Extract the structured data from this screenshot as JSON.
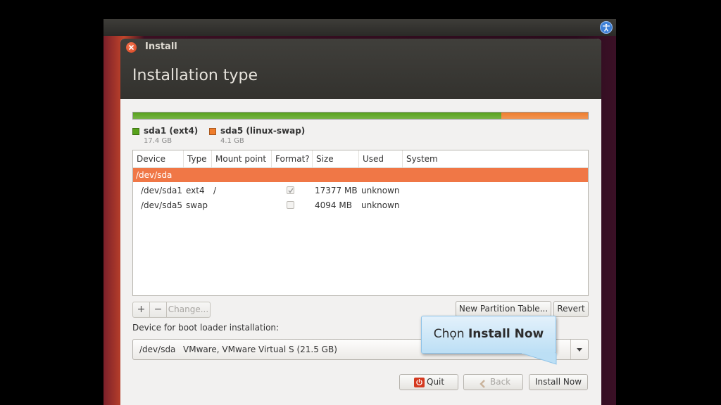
{
  "window": {
    "title": "Install",
    "page_title": "Installation type"
  },
  "partitions": [
    {
      "name": "sda1 (ext4)",
      "size": "17.4 GB",
      "color": "#57a21b",
      "fraction": 0.81
    },
    {
      "name": "sda5 (linux-swap)",
      "size": "4.1 GB",
      "color": "#ef7d2c",
      "fraction": 0.19
    }
  ],
  "table": {
    "columns": [
      "Device",
      "Type",
      "Mount point",
      "Format?",
      "Size",
      "Used",
      "System"
    ],
    "disk": "/dev/sda",
    "rows": [
      {
        "device": "/dev/sda1",
        "type": "ext4",
        "mount": "/",
        "format": true,
        "size": "17377 MB",
        "used": "unknown",
        "system": ""
      },
      {
        "device": "/dev/sda5",
        "type": "swap",
        "mount": "",
        "format": false,
        "size": "4094 MB",
        "used": "unknown",
        "system": ""
      }
    ]
  },
  "controls": {
    "add_label": "+",
    "remove_label": "−",
    "change_label": "Change...",
    "new_table_label": "New Partition Table...",
    "revert_label": "Revert"
  },
  "bootloader": {
    "label": "Device for boot loader installation:",
    "device": "/dev/sda",
    "description": "VMware, VMware Virtual S (21.5 GB)"
  },
  "buttons": {
    "quit": "Quit",
    "back": "Back",
    "install": "Install Now"
  },
  "tooltip": {
    "prefix": "Chọn ",
    "emphasis": "Install Now"
  },
  "colors": {
    "selection": "#f07746",
    "accent": "#dd4814"
  }
}
